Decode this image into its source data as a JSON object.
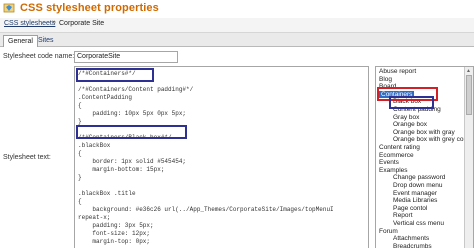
{
  "window": {
    "title": "CSS stylesheet properties"
  },
  "breadcrumb": {
    "parent": "CSS stylesheets",
    "separator": "»",
    "current": "Corporate Site"
  },
  "tabs": [
    {
      "label": "General"
    },
    {
      "label": "Sites"
    }
  ],
  "form": {
    "code_name_label": "Stylesheet code name:",
    "code_name_value": "CorporateSite",
    "text_label": "Stylesheet text:"
  },
  "code_lines": [
    "/*#Containers#*/",
    "",
    "/*#Containers/Content padding#*/",
    ".ContentPadding",
    "{",
    "    padding: 10px 5px 0px 5px;",
    "}",
    "",
    "/*#Containers/Black box#*/",
    ".blackBox",
    "{",
    "    border: 1px solid #545454;",
    "    margin-bottom: 15px;",
    "}",
    "",
    ".blackBox .title",
    "{",
    "    background: #e36c26 url(../App_Themes/CorporateSite/Images/topMenuI",
    "repeat-x;",
    "    padding: 3px 5px;",
    "    font-size: 12px;",
    "    margin-top: 0px;"
  ],
  "tree_items": [
    {
      "label": "Abuse report",
      "level": 0
    },
    {
      "label": "Blog",
      "level": 0
    },
    {
      "label": "Board",
      "level": 0
    },
    {
      "label": "Containers",
      "level": 0,
      "selected": true
    },
    {
      "label": "Black box",
      "level": 1
    },
    {
      "label": "Content padding",
      "level": 1
    },
    {
      "label": "Gray box",
      "level": 1
    },
    {
      "label": "Orange box",
      "level": 1
    },
    {
      "label": "Orange box with gray",
      "level": 1
    },
    {
      "label": "Orange box with grey con",
      "level": 1
    },
    {
      "label": "Content rating",
      "level": 0
    },
    {
      "label": "Ecommerce",
      "level": 0
    },
    {
      "label": "Events",
      "level": 0
    },
    {
      "label": "Examples",
      "level": 0
    },
    {
      "label": "Change password",
      "level": 1
    },
    {
      "label": "Drop down menu",
      "level": 1
    },
    {
      "label": "Event manager",
      "level": 1
    },
    {
      "label": "Media Libraries",
      "level": 1
    },
    {
      "label": "Page contol",
      "level": 1
    },
    {
      "label": "Report",
      "level": 1
    },
    {
      "label": "Vertical css menu",
      "level": 1
    },
    {
      "label": "Forum",
      "level": 0
    },
    {
      "label": "Attachments",
      "level": 1
    },
    {
      "label": "Breadcrumbs",
      "level": 1
    }
  ],
  "icons": {
    "app": "css-stylesheet-icon",
    "scroll_up": "arrow-up-icon"
  },
  "colors": {
    "title": "#d06a00",
    "annotation_blue": "#2e3192",
    "annotation_red": "#d32027",
    "selection": "#2f6bc4"
  }
}
